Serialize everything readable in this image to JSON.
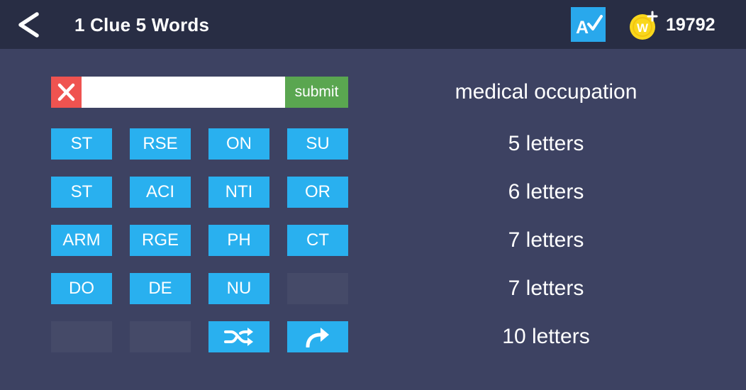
{
  "header": {
    "title": "1 Clue 5 Words",
    "coins": "19792",
    "icons": {
      "back": "chevron-left-icon",
      "hint": "letter-a-check-icon",
      "coin": "coin-plus-icon"
    }
  },
  "input": {
    "value": "",
    "placeholder": "",
    "submit_label": "submit"
  },
  "tiles": [
    [
      "ST",
      "RSE",
      "ON",
      "SU"
    ],
    [
      "ST",
      "ACI",
      "NTI",
      "OR"
    ],
    [
      "ARM",
      "RGE",
      "PH",
      "CT"
    ],
    [
      "DO",
      "DE",
      "NU",
      ""
    ],
    [
      "",
      "",
      "",
      ""
    ]
  ],
  "controls": {
    "shuffle_icon": "shuffle-icon",
    "skip_icon": "share-arrow-icon"
  },
  "clue": {
    "text": "medical occupation",
    "word_lengths": [
      "5 letters",
      "6 letters",
      "7 letters",
      "7 letters",
      "10 letters"
    ]
  },
  "colors": {
    "background": "#3d4262",
    "topbar": "#282d44",
    "tile": "#29b0ef",
    "tile_empty": "#454a68",
    "clear": "#ef5350",
    "submit": "#5aa650",
    "coin": "#f9d71c"
  }
}
